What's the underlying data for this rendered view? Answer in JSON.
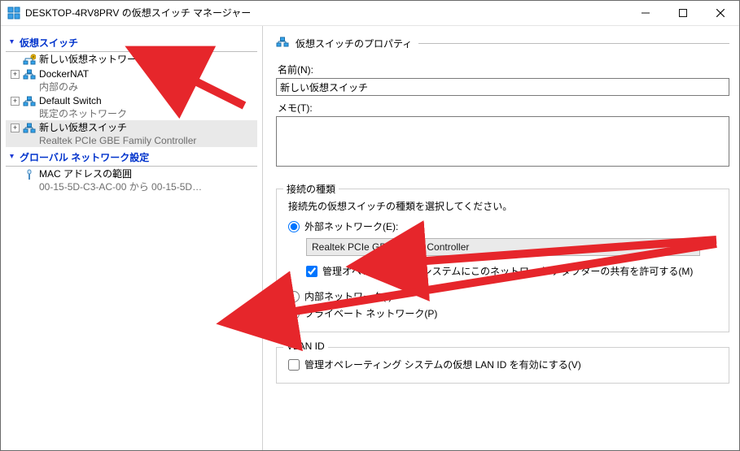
{
  "window": {
    "title": "DESKTOP-4RV8PRV の仮想スイッチ マネージャー"
  },
  "tree": {
    "section_switches": "仮想スイッチ",
    "section_global": "グローバル ネットワーク設定",
    "items": [
      {
        "label": "新しい仮想ネットワーク スイッチ",
        "sub": null
      },
      {
        "label": "DockerNAT",
        "sub": "内部のみ"
      },
      {
        "label": "Default Switch",
        "sub": "既定のネットワーク"
      },
      {
        "label": "新しい仮想スイッチ",
        "sub": "Realtek PCIe GBE Family Controller"
      }
    ],
    "global_items": [
      {
        "label": "MAC アドレスの範囲",
        "sub": "00-15-5D-C3-AC-00 から 00-15-5D…"
      }
    ]
  },
  "props": {
    "heading": "仮想スイッチのプロパティ",
    "name_label": "名前(N):",
    "name_value": "新しい仮想スイッチ",
    "memo_label": "メモ(T):",
    "memo_value": ""
  },
  "connection": {
    "group_title": "接続の種類",
    "desc": "接続先の仮想スイッチの種類を選択してください。",
    "radio_external": "外部ネットワーク(E):",
    "adapter_selected": "Realtek PCIe GBE Family Controller",
    "checkbox_share": "管理オペレーティング システムにこのネットワーク アダプターの共有を許可する(M)",
    "radio_internal": "内部ネットワーク(I)",
    "radio_private": "プライベート ネットワーク(P)"
  },
  "vlan": {
    "group_title": "VLAN ID",
    "checkbox_enable": "管理オペレーティング システムの仮想 LAN ID を有効にする(V)"
  }
}
